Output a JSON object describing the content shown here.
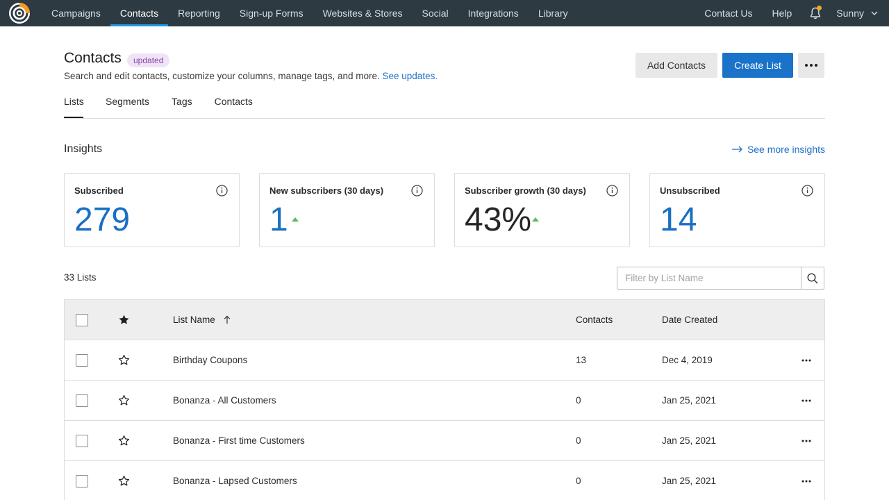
{
  "nav": {
    "items": [
      {
        "label": "Campaigns"
      },
      {
        "label": "Contacts",
        "active": true
      },
      {
        "label": "Reporting"
      },
      {
        "label": "Sign-up Forms"
      },
      {
        "label": "Websites & Stores"
      },
      {
        "label": "Social"
      },
      {
        "label": "Integrations"
      },
      {
        "label": "Library"
      }
    ],
    "contact_us": "Contact Us",
    "help": "Help",
    "user_name": "Sunny"
  },
  "header": {
    "title": "Contacts",
    "badge": "updated",
    "subtitle": "Search and edit contacts, customize your columns, manage tags, and more.",
    "subtitle_link": "See updates.",
    "add_contacts": "Add Contacts",
    "create_list": "Create List"
  },
  "tabs": [
    "Lists",
    "Segments",
    "Tags",
    "Contacts"
  ],
  "insights": {
    "title": "Insights",
    "see_more": "See more insights",
    "cards": [
      {
        "label": "Subscribed",
        "value": "279"
      },
      {
        "label": "New subscribers (30 days)",
        "value": "1"
      },
      {
        "label": "Subscriber growth (30 days)",
        "value": "43%"
      },
      {
        "label": "Unsubscribed",
        "value": "14"
      }
    ]
  },
  "lists": {
    "count": "33 Lists",
    "filter_placeholder": "Filter by List Name",
    "columns": {
      "name": "List Name",
      "contacts": "Contacts",
      "date": "Date Created"
    },
    "rows": [
      {
        "name": "Birthday Coupons",
        "contacts": "13",
        "date": "Dec 4, 2019"
      },
      {
        "name": "Bonanza - All Customers",
        "contacts": "0",
        "date": "Jan 25, 2021"
      },
      {
        "name": "Bonanza - First time Customers",
        "contacts": "0",
        "date": "Jan 25, 2021"
      },
      {
        "name": "Bonanza - Lapsed Customers",
        "contacts": "0",
        "date": "Jan 25, 2021"
      }
    ]
  },
  "colors": {
    "nav_bg": "#2d3a42",
    "accent": "#1a73c9",
    "link": "#1f6fc5",
    "positive": "#5cb85c",
    "badge_bg": "#efe4f5",
    "badge_text": "#8a3fb0"
  }
}
